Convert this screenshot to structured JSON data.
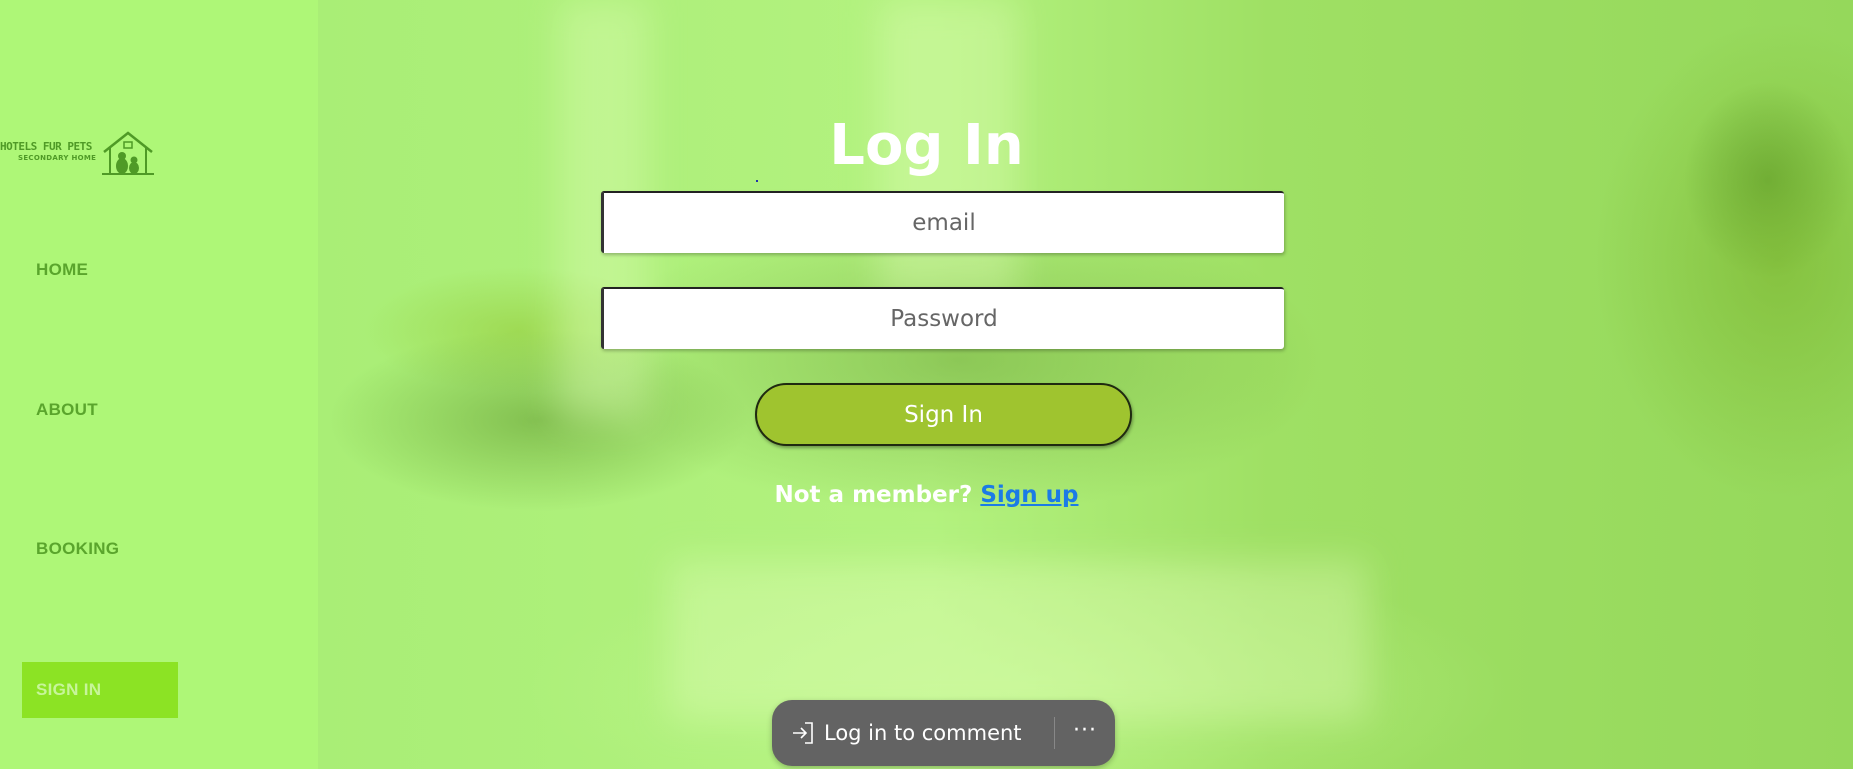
{
  "sidebar": {
    "logo": {
      "title": "HOTELS FUR PETS",
      "subtitle": "SECONDARY HOME",
      "icon": "house-pets-icon"
    },
    "items": [
      {
        "label": "HOME"
      },
      {
        "label": "ABOUT"
      },
      {
        "label": "BOOKING"
      },
      {
        "label": "SIGN IN",
        "active": true
      }
    ]
  },
  "login": {
    "title": "Log In",
    "email": {
      "placeholder": "email",
      "value": ""
    },
    "password": {
      "placeholder": "Password",
      "value": ""
    },
    "submit_label": "Sign In",
    "member_prompt": "Not a member?",
    "signup_link": "Sign up"
  },
  "comment_bar": {
    "label": "Log in to comment",
    "icon": "login-arrow-icon",
    "more_label": "···"
  },
  "colors": {
    "sidebar_bg": "#aef777",
    "nav_text": "#5aa52c",
    "nav_active_bg": "#8ce324",
    "button_bg": "#9fc42f",
    "link": "#1b7be6",
    "pill_bg": "#636363"
  }
}
